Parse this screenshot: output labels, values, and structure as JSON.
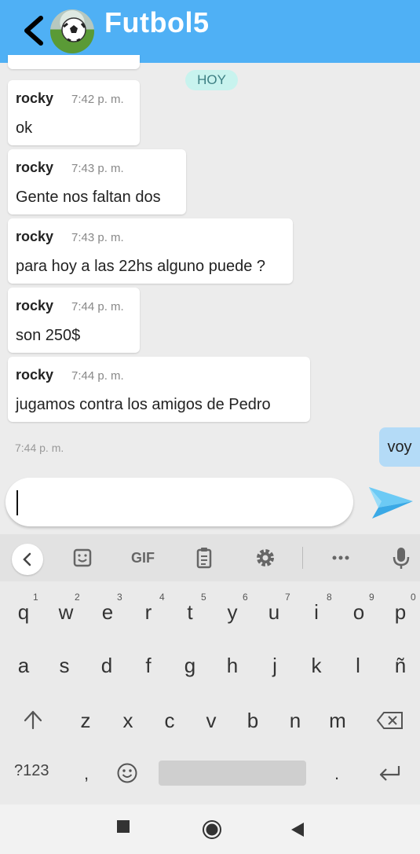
{
  "header": {
    "title": "Futbol5",
    "back_icon": "back-arrow-icon",
    "avatar": "soccer-ball-avatar"
  },
  "colors": {
    "header": "#4fb0f5",
    "my_bubble": "#b4dbf7",
    "date_chip": "#c8f3ee",
    "send": "#4cb8f0"
  },
  "chat": {
    "date_label": "HOY",
    "messages": [
      {
        "sender": "rocky",
        "time": "7:42 p. m.",
        "text": "ok"
      },
      {
        "sender": "rocky",
        "time": "7:43 p. m.",
        "text": "Gente nos faltan dos"
      },
      {
        "sender": "rocky",
        "time": "7:43 p. m.",
        "text": "para hoy a las 22hs alguno puede ?"
      },
      {
        "sender": "rocky",
        "time": "7:44 p. m.",
        "text": "son 250$"
      },
      {
        "sender": "rocky",
        "time": "7:44 p. m.",
        "text": "jugamos contra los amigos de Pedro"
      }
    ],
    "my_message": {
      "text": "voy",
      "time": "7:44 p. m."
    }
  },
  "composer": {
    "value": "",
    "send_icon": "paper-plane-send-icon"
  },
  "keyboard": {
    "toolbar": {
      "gif": "GIF",
      "icons": [
        "back-icon",
        "sticker-icon",
        "gif-icon",
        "clipboard-icon",
        "settings-icon",
        "more-icon",
        "mic-icon"
      ]
    },
    "row1": [
      "q",
      "w",
      "e",
      "r",
      "t",
      "y",
      "u",
      "i",
      "o",
      "p"
    ],
    "row1_nums": [
      "1",
      "2",
      "3",
      "4",
      "5",
      "6",
      "7",
      "8",
      "9",
      "0"
    ],
    "row2": [
      "a",
      "s",
      "d",
      "f",
      "g",
      "h",
      "j",
      "k",
      "l",
      "ñ"
    ],
    "row3": [
      "z",
      "x",
      "c",
      "v",
      "b",
      "n",
      "m"
    ],
    "bottom": {
      "symbols": "?123",
      "comma": ",",
      "period": "."
    }
  },
  "navbar": {
    "icons": [
      "recent-apps-icon",
      "home-icon",
      "back-triangle-icon"
    ]
  }
}
